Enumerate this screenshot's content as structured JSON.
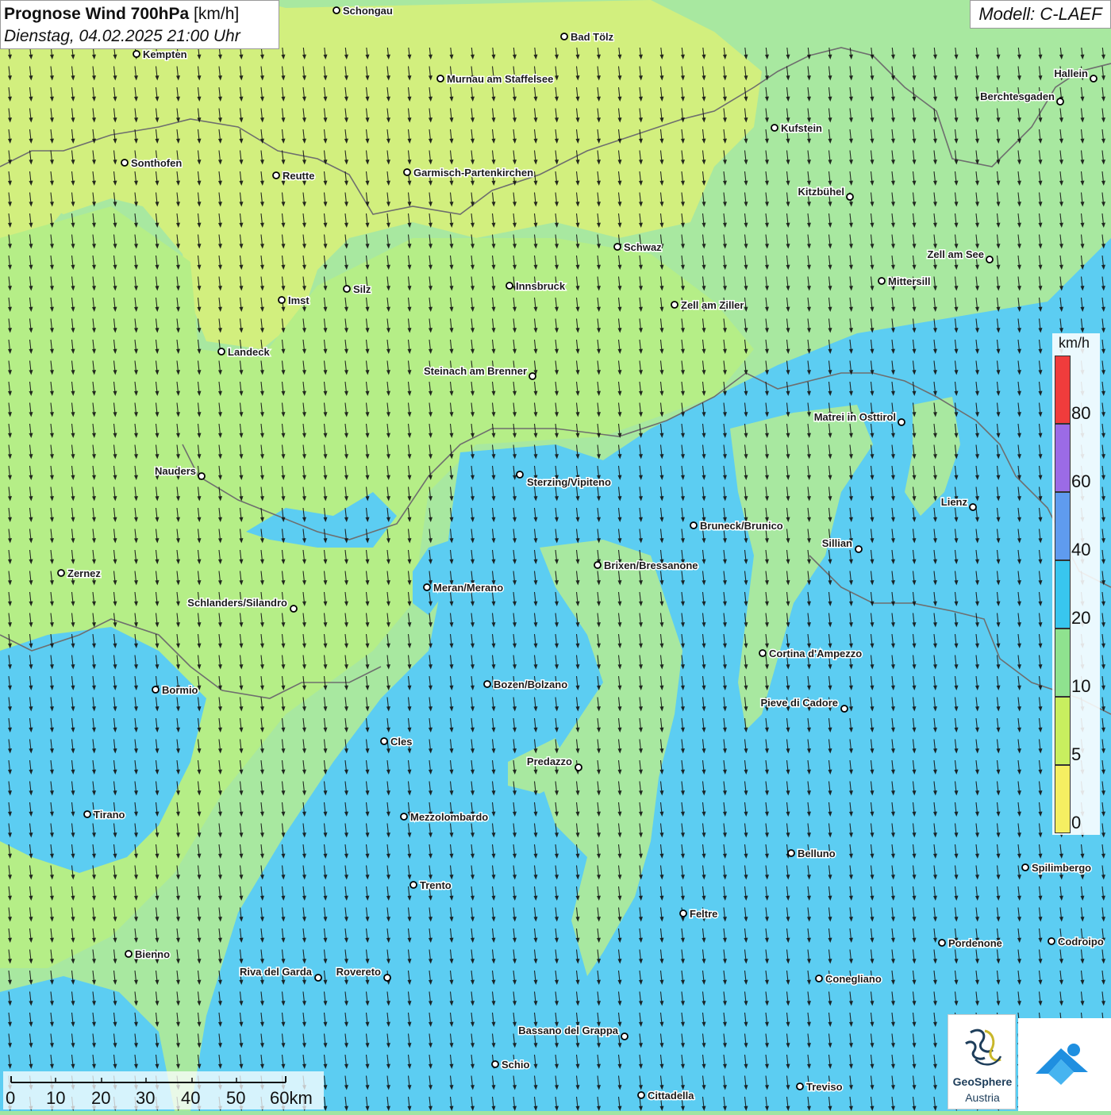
{
  "title": {
    "main": "Prognose Wind 700hPa",
    "unit": "[km/h]",
    "datetime": "Dienstag, 04.02.2025 21:00 Uhr"
  },
  "model_label": "Modell: C-LAEF",
  "legend": {
    "unit": "km/h",
    "ticks": [
      "80",
      "60",
      "40",
      "20",
      "10",
      "5",
      "0"
    ],
    "colors": [
      "#f03c3c",
      "#9b6be6",
      "#5f9bef",
      "#38c6ef",
      "#8fe28f",
      "#c8ef5f",
      "#f5ef62"
    ]
  },
  "scalebar": {
    "ticks": [
      "0",
      "10",
      "20",
      "30",
      "40",
      "50",
      "60km"
    ]
  },
  "logo": {
    "name": "GeoSphere",
    "sub": "Austria"
  },
  "colors": {
    "yellow_green": "#d2ef7e",
    "light_green": "#a8e8a0",
    "mid_green": "#b5ee87",
    "cyan": "#5ccdf2",
    "border": "#7b7b7b",
    "arrow": "#111111"
  },
  "cities": [
    {
      "name": "Schongau"
    },
    {
      "name": "Bad Tölz"
    },
    {
      "name": "Kempten"
    },
    {
      "name": "Murnau am Staffelsee"
    },
    {
      "name": "Hallein"
    },
    {
      "name": "Berchtesgaden"
    },
    {
      "name": "Kufstein"
    },
    {
      "name": "Sonthofen"
    },
    {
      "name": "Reutte"
    },
    {
      "name": "Garmisch-Partenkirchen"
    },
    {
      "name": "Kitzbühel"
    },
    {
      "name": "Schwaz"
    },
    {
      "name": "Zell am See"
    },
    {
      "name": "Mittersill"
    },
    {
      "name": "Imst"
    },
    {
      "name": "Silz"
    },
    {
      "name": "Innsbruck"
    },
    {
      "name": "Zell am Ziller"
    },
    {
      "name": "Landeck"
    },
    {
      "name": "Steinach am Brenner"
    },
    {
      "name": "Matrei in Osttirol"
    },
    {
      "name": "Nauders"
    },
    {
      "name": "Sterzing/Vipiteno"
    },
    {
      "name": "Lienz"
    },
    {
      "name": "Bruneck/Brunico"
    },
    {
      "name": "Sillian"
    },
    {
      "name": "Zernez"
    },
    {
      "name": "Brixen/Bressanone"
    },
    {
      "name": "Meran/Merano"
    },
    {
      "name": "Schlanders/Silandro"
    },
    {
      "name": "Cortina d'Ampezzo"
    },
    {
      "name": "Bozen/Bolzano"
    },
    {
      "name": "Bormio"
    },
    {
      "name": "Pieve di Cadore"
    },
    {
      "name": "Cles"
    },
    {
      "name": "Predazzo"
    },
    {
      "name": "Tirano"
    },
    {
      "name": "Mezzolombardo"
    },
    {
      "name": "Belluno"
    },
    {
      "name": "Spilimbergo"
    },
    {
      "name": "Trento"
    },
    {
      "name": "Feltre"
    },
    {
      "name": "Pordenone"
    },
    {
      "name": "Codroipo"
    },
    {
      "name": "Bienno"
    },
    {
      "name": "Riva del Garda"
    },
    {
      "name": "Rovereto"
    },
    {
      "name": "Conegliano"
    },
    {
      "name": "Bassano del Grappa"
    },
    {
      "name": "Schio"
    },
    {
      "name": "Treviso"
    },
    {
      "name": "Cittadella"
    }
  ]
}
